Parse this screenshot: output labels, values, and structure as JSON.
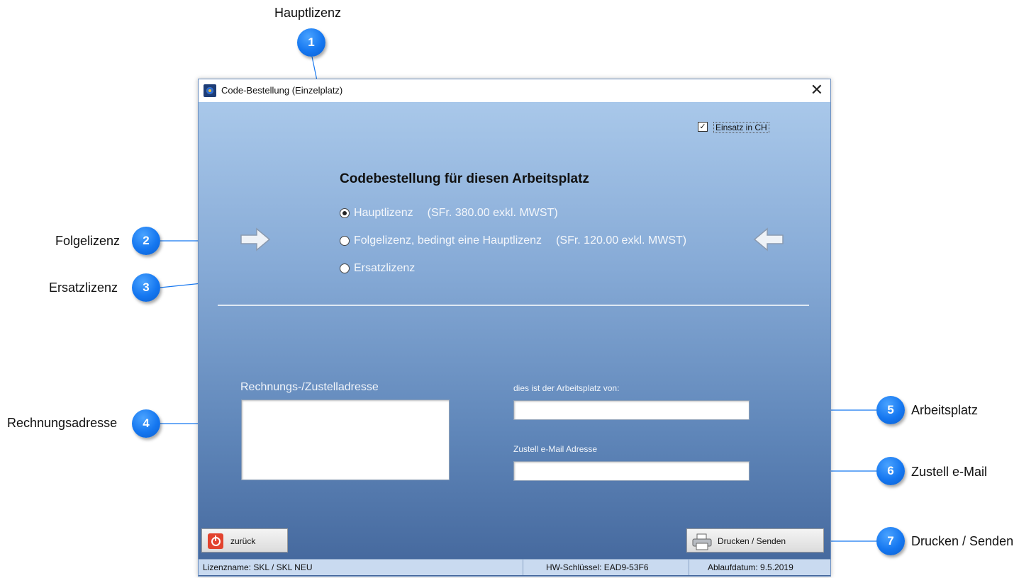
{
  "annotations": [
    {
      "number": "1",
      "label": "Hauptlizenz"
    },
    {
      "number": "2",
      "label": "Folgelizenz"
    },
    {
      "number": "3",
      "label": "Ersatzlizenz"
    },
    {
      "number": "4",
      "label": "Rechnungsadresse"
    },
    {
      "number": "5",
      "label": "Arbeitsplatz"
    },
    {
      "number": "6",
      "label": "Zustell e-Mail"
    },
    {
      "number": "7",
      "label": "Drucken / Senden"
    }
  ],
  "window": {
    "title": "Code-Bestellung (Einzelplatz)",
    "close_symbol": "✕"
  },
  "checkbox": {
    "label": "Einsatz in CH",
    "checked": true
  },
  "heading": "Codebestellung für diesen Arbeitsplatz",
  "radios": [
    {
      "label": "Hauptlizenz",
      "price": "(SFr. 380.00 exkl. MWST)",
      "checked": true
    },
    {
      "label": "Folgelizenz, bedingt eine Hauptlizenz",
      "price": "(SFr. 120.00 exkl. MWST)",
      "checked": false
    },
    {
      "label": "Ersatzlizenz",
      "price": "",
      "checked": false
    }
  ],
  "address_label": "Rechnungs-/Zustelladresse",
  "address_value": "",
  "workplace_label": "dies ist der Arbeitsplatz von:",
  "workplace_value": "",
  "email_label": "Zustell e-Mail Adresse",
  "email_value": "",
  "buttons": {
    "back": "zurück",
    "print": "Drucken / Senden"
  },
  "status": {
    "license": "Lizenzname: SKL / SKL NEU",
    "hw_key": "HW-Schlüssel: EAD9-53F6",
    "expiry": "Ablaufdatum: 9.5.2019"
  },
  "icons": [
    "app-icon",
    "close-icon",
    "checkbox-check-icon",
    "arrow-right-icon",
    "arrow-left-icon",
    "power-icon",
    "printer-icon"
  ],
  "colors": {
    "badge": "#1577f0",
    "client_top": "#a9c8ea",
    "client_bottom": "#43669b",
    "back_icon": "#e2432e"
  }
}
